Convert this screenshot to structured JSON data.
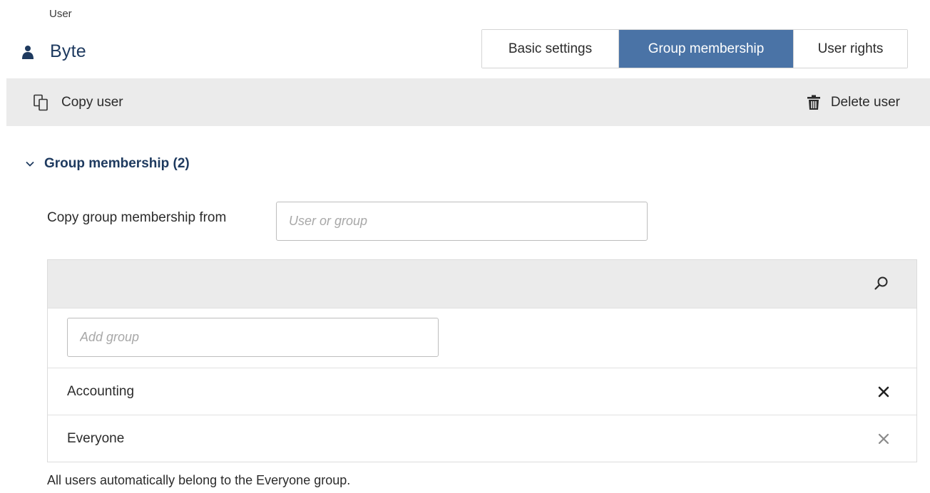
{
  "breadcrumb": "User",
  "page": {
    "title": "Byte",
    "icon": "user-icon"
  },
  "tabs": [
    {
      "label": "Basic settings",
      "active": false
    },
    {
      "label": "Group membership",
      "active": true
    },
    {
      "label": "User rights",
      "active": false
    }
  ],
  "toolbar": {
    "copy_label": "Copy user",
    "copy_icon": "copy-icon",
    "delete_label": "Delete user",
    "delete_icon": "trash-icon"
  },
  "section": {
    "title": "Group membership (2)",
    "expanded": true,
    "icon": "chevron-down-icon"
  },
  "copy_membership": {
    "label": "Copy group membership from",
    "placeholder": "User or group",
    "value": ""
  },
  "group_list": {
    "search_icon": "search-icon",
    "add_placeholder": "Add group",
    "groups": [
      {
        "name": "Accounting",
        "removable": true
      },
      {
        "name": "Everyone",
        "removable": false
      }
    ]
  },
  "footnote": "All users automatically belong to the Everyone group.",
  "colors": {
    "accent": "#4a73a6",
    "title": "#1e3a5f",
    "toolbar_bg": "#ebebeb",
    "remove_active": "#222222",
    "remove_disabled": "#8a8a8a"
  }
}
